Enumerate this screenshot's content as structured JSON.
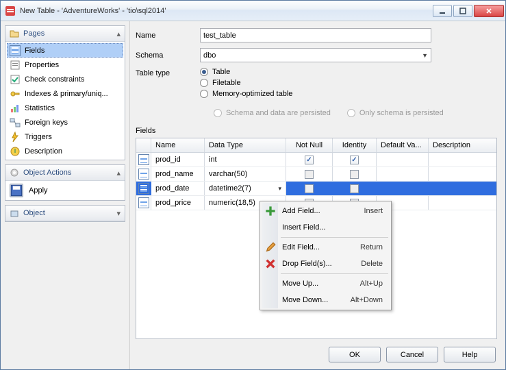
{
  "window": {
    "title": "New Table - 'AdventureWorks' - 'tio\\sql2014'"
  },
  "sidebar": {
    "pages": {
      "title": "Pages",
      "items": [
        {
          "label": "Fields"
        },
        {
          "label": "Properties"
        },
        {
          "label": "Check constraints"
        },
        {
          "label": "Indexes & primary/uniq..."
        },
        {
          "label": "Statistics"
        },
        {
          "label": "Foreign keys"
        },
        {
          "label": "Triggers"
        },
        {
          "label": "Description"
        }
      ]
    },
    "actions": {
      "title": "Object Actions",
      "apply": "Apply"
    },
    "object": {
      "title": "Object"
    }
  },
  "form": {
    "name_label": "Name",
    "name_value": "test_table",
    "schema_label": "Schema",
    "schema_value": "dbo",
    "type_label": "Table type",
    "type_opts": {
      "table": "Table",
      "filetable": "Filetable",
      "memopt": "Memory-optimized table"
    },
    "sub_opts": {
      "both": "Schema and data are persisted",
      "schema": "Only schema is persisted"
    }
  },
  "fields": {
    "label": "Fields",
    "columns": {
      "name": "Name",
      "type": "Data Type",
      "notnull": "Not Null",
      "identity": "Identity",
      "defval": "Default Va...",
      "desc": "Description"
    },
    "rows": [
      {
        "name": "prod_id",
        "type": "int",
        "notnull": true,
        "identity": true
      },
      {
        "name": "prod_name",
        "type": "varchar(50)",
        "notnull": false,
        "identity": false
      },
      {
        "name": "prod_date",
        "type": "datetime2(7)",
        "notnull": false,
        "identity": false
      },
      {
        "name": "prod_price",
        "type": "numeric(18,5)",
        "notnull": false,
        "identity": false
      }
    ]
  },
  "context_menu": {
    "items": [
      {
        "label": "Add Field...",
        "shortcut": "Insert",
        "icon": "plus"
      },
      {
        "label": "Insert Field...",
        "shortcut": ""
      },
      {
        "sep": true
      },
      {
        "label": "Edit Field...",
        "shortcut": "Return",
        "icon": "pencil"
      },
      {
        "label": "Drop Field(s)...",
        "shortcut": "Delete",
        "icon": "cross"
      },
      {
        "sep": true
      },
      {
        "label": "Move Up...",
        "shortcut": "Alt+Up"
      },
      {
        "label": "Move Down...",
        "shortcut": "Alt+Down"
      }
    ]
  },
  "buttons": {
    "ok": "OK",
    "cancel": "Cancel",
    "help": "Help"
  }
}
